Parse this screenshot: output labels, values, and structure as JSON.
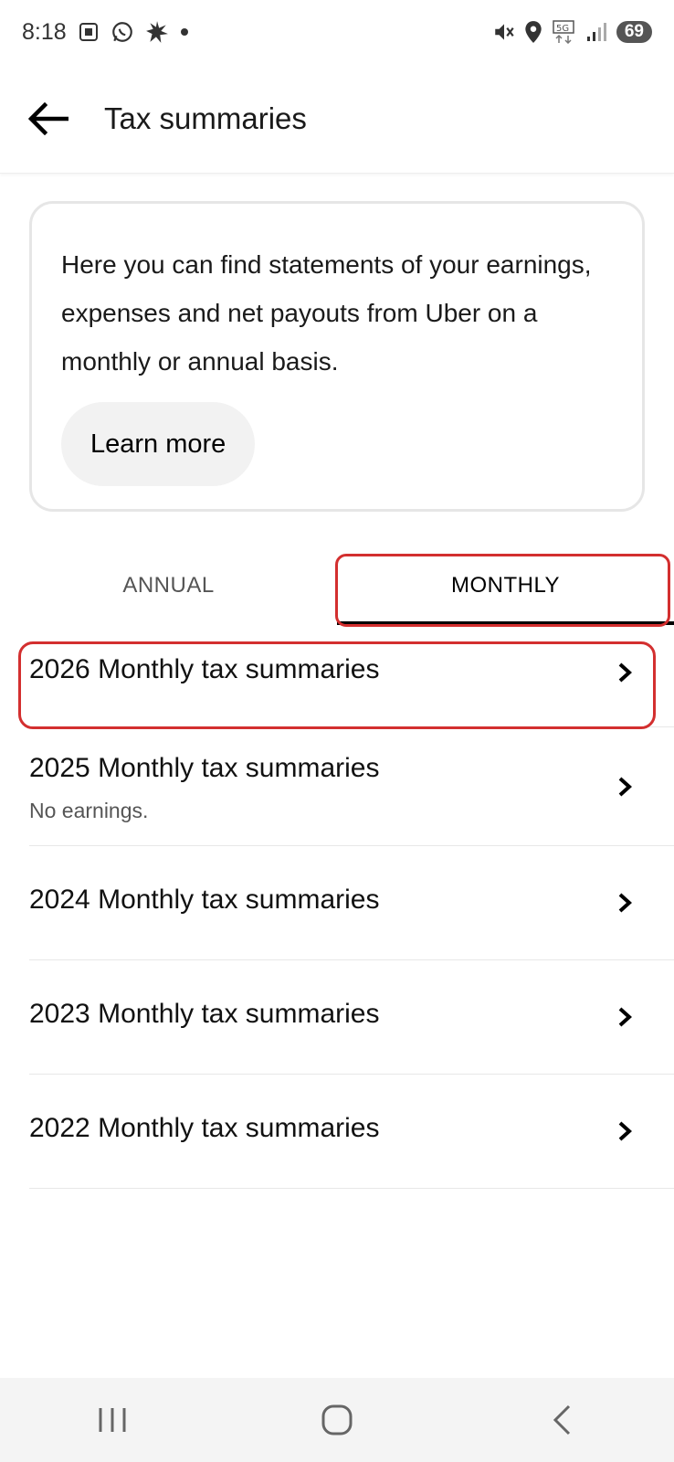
{
  "status_bar": {
    "time": "8:18",
    "battery": "69",
    "left_icons": [
      "screenshot-icon",
      "whatsapp-icon",
      "burst-icon"
    ],
    "right_icons": [
      "mute-icon",
      "location-icon",
      "5g-icon",
      "signal-icon",
      "battery-icon"
    ]
  },
  "header": {
    "title": "Tax summaries",
    "back_icon": "arrow-left-icon"
  },
  "info_card": {
    "text": "Here you can find statements of your earnings, expenses and net payouts from Uber on a monthly or annual basis.",
    "button_label": "Learn more"
  },
  "tabs": [
    {
      "label": "ANNUAL",
      "selected": false
    },
    {
      "label": "MONTHLY",
      "selected": true
    }
  ],
  "summaries": [
    {
      "title": "2026 Monthly tax summaries",
      "subtitle": ""
    },
    {
      "title": "2025 Monthly tax summaries",
      "subtitle": "No earnings."
    },
    {
      "title": "2024 Monthly tax summaries",
      "subtitle": ""
    },
    {
      "title": "2023 Monthly tax summaries",
      "subtitle": ""
    },
    {
      "title": "2022 Monthly tax summaries",
      "subtitle": ""
    }
  ],
  "colors": {
    "highlight": "#d32f2f",
    "tab_indicator": "#000000",
    "card_border": "#e6e6e6",
    "button_bg": "#f2f2f2"
  },
  "nav_bar": {
    "icons": [
      "recent-apps-icon",
      "home-icon",
      "back-icon"
    ]
  }
}
